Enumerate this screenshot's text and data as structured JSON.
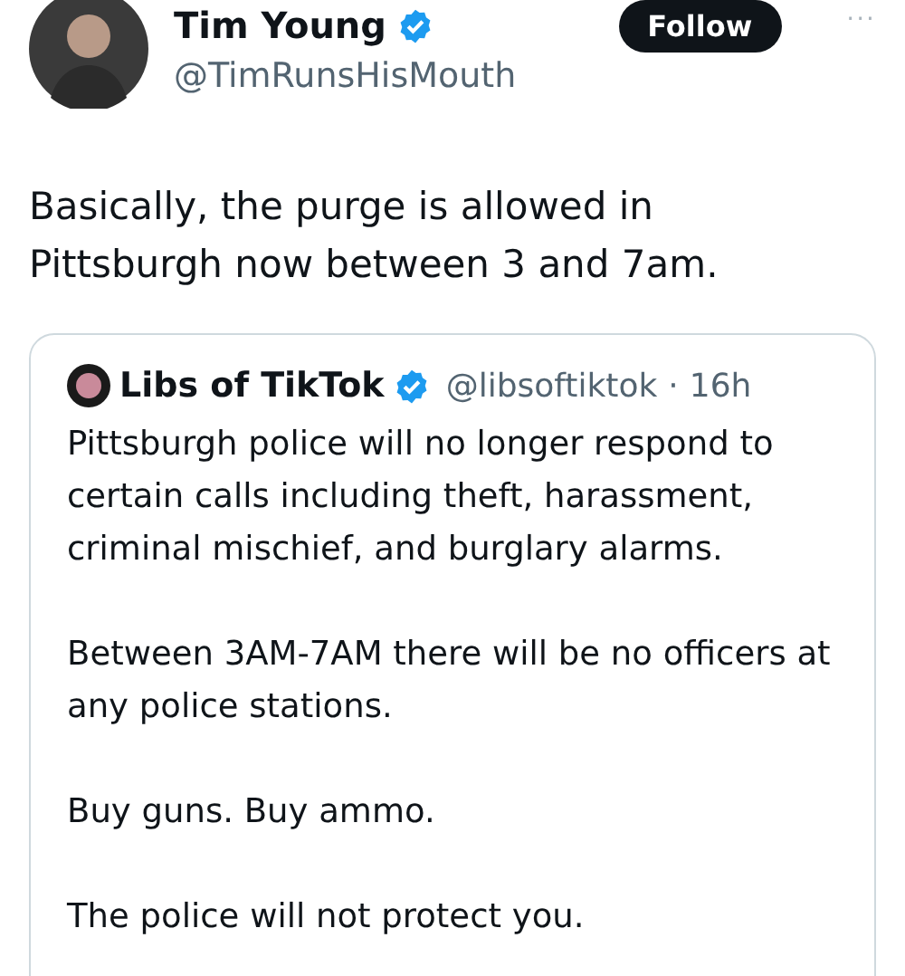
{
  "author": {
    "name": "Tim Young",
    "verified": true,
    "handle": "@TimRunsHisMouth"
  },
  "follow_button": "Follow",
  "more_menu": "···",
  "tweet_text": [
    "Basically, the purge is allowed in",
    "Pittsburgh now between 3 and 7am."
  ],
  "quoted_tweet": {
    "name": "Libs of TikTok",
    "verified": true,
    "handle": "@libsoftiktok",
    "separator": "·",
    "time": "16h",
    "paragraphs": [
      "Pittsburgh police will no longer respond to certain calls including theft, harassment, criminal mischief, and burglary alarms.",
      "Between 3AM-7AM there will be no officers at any police stations.",
      "Buy guns. Buy ammo.",
      "The police will not protect you."
    ]
  }
}
